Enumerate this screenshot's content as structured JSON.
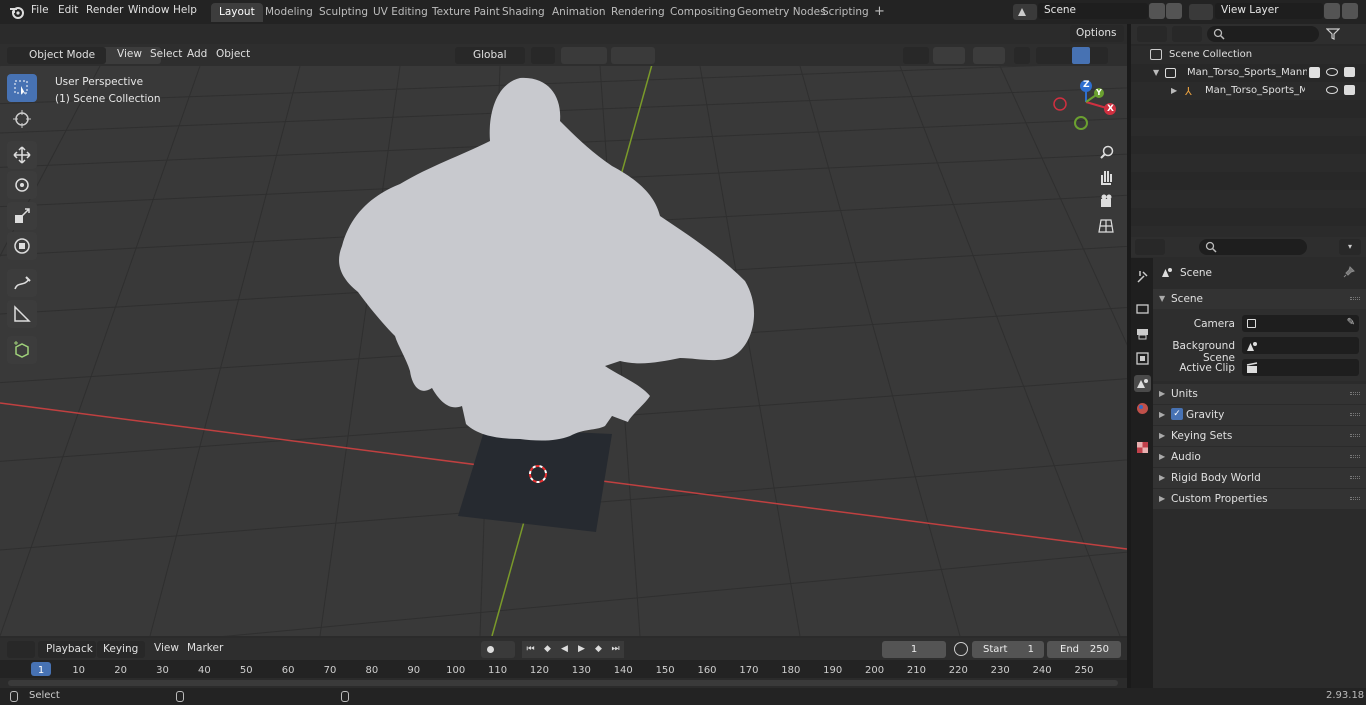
{
  "topbar": {
    "menus": [
      "File",
      "Edit",
      "Render",
      "Window",
      "Help"
    ],
    "workspaces": [
      "Layout",
      "Modeling",
      "Sculpting",
      "UV Editing",
      "Texture Paint",
      "Shading",
      "Animation",
      "Rendering",
      "Compositing",
      "Geometry Nodes",
      "Scripting"
    ],
    "active_workspace": "Layout",
    "add_tab": "+",
    "scene_name": "Scene",
    "view_layer": "View Layer"
  },
  "viewport_header": {
    "mode": "Object Mode",
    "menus": [
      "View",
      "Select",
      "Add",
      "Object"
    ],
    "transform_orientation": "Global",
    "options": "Options"
  },
  "viewport": {
    "perspective": "User Perspective",
    "collection": "(1) Scene Collection",
    "axis_labels": {
      "x": "X",
      "y": "Y",
      "z": "Z"
    }
  },
  "outliner": {
    "root": "Scene Collection",
    "items": [
      "Man_Torso_Sports_Mannequin",
      "Man_Torso_Sports_Manne"
    ]
  },
  "properties": {
    "context": "Scene",
    "panel_title": "Scene",
    "fields": [
      {
        "label": "Camera"
      },
      {
        "label": "Background Scene"
      },
      {
        "label": "Active Clip"
      }
    ],
    "subpanels": [
      "Units",
      "Gravity",
      "Keying Sets",
      "Audio",
      "Rigid Body World",
      "Custom Properties"
    ]
  },
  "timeline": {
    "menus": [
      "Playback",
      "Keying",
      "View",
      "Marker"
    ],
    "current_frame": "1",
    "start_label": "Start",
    "start": "1",
    "end_label": "End",
    "end": "250",
    "ruler": [
      "1",
      "10",
      "20",
      "30",
      "40",
      "50",
      "60",
      "70",
      "80",
      "90",
      "100",
      "110",
      "120",
      "130",
      "140",
      "150",
      "160",
      "170",
      "180",
      "190",
      "200",
      "210",
      "220",
      "230",
      "240",
      "250"
    ]
  },
  "statusbar": {
    "left": "Select",
    "version": "2.93.18"
  },
  "colors": {
    "accent": "#4772b3",
    "x_axis": "#c04040",
    "y_axis": "#7a9a2a",
    "mesh": "#c8c9ce"
  }
}
